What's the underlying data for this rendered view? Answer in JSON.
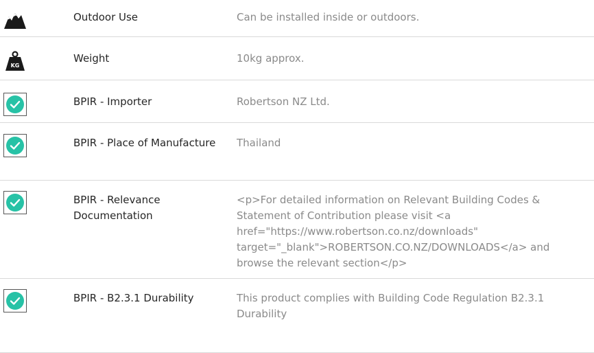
{
  "rows": [
    {
      "icon": "mountain-icon",
      "label": "Outdoor Use",
      "value": "Can be installed inside or outdoors."
    },
    {
      "icon": "weight-kg-icon",
      "label": "Weight",
      "value": "10kg approx."
    },
    {
      "icon": "check-circle-icon",
      "label": "BPIR - Importer",
      "value": "Robertson NZ Ltd."
    },
    {
      "icon": "check-circle-icon",
      "label": "BPIR - Place of Manufacture",
      "value": "Thailand"
    },
    {
      "icon": "check-circle-icon",
      "label": "BPIR - Relevance Documentation",
      "value": "<p>For detailed information on Relevant Building Codes & Statement of Contribution please visit <a href=\"https://www.robertson.co.nz/downloads\" target=\"_blank\">ROBERTSON.CO.NZ/DOWNLOADS</a> and browse the relevant section</p>"
    },
    {
      "icon": "check-circle-icon",
      "label": "BPIR - B2.3.1 Durability",
      "value": "This product complies with Building Code Regulation B2.3.1 Durability"
    }
  ],
  "colors": {
    "check": "#27c2a6",
    "icon_dark": "#1a1a1a",
    "label": "#262626",
    "value": "#8a8a8a",
    "divider": "#d9d9d9"
  },
  "kg_badge": "KG"
}
